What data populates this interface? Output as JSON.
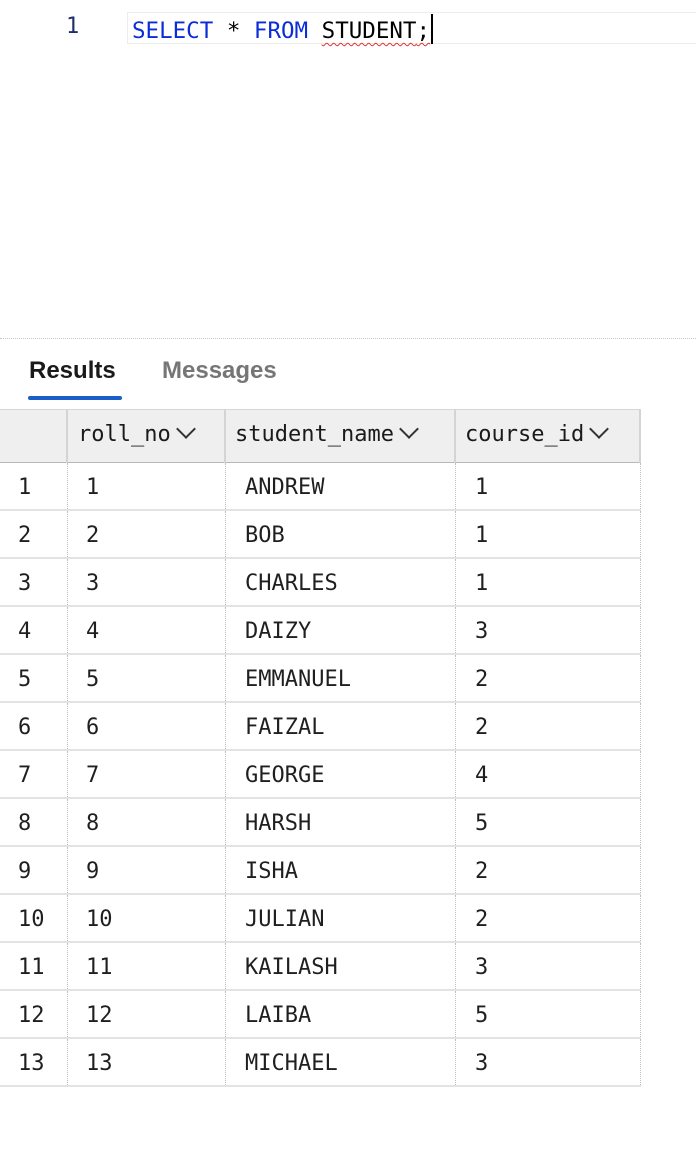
{
  "editor": {
    "line_number": "1",
    "code": {
      "kw_select": "SELECT",
      "star": "*",
      "kw_from": "FROM",
      "table": "STUDENT",
      "terminator": ";"
    }
  },
  "tabs": [
    {
      "label": "Results",
      "active": true
    },
    {
      "label": "Messages",
      "active": false
    }
  ],
  "grid": {
    "columns": [
      "roll_no",
      "student_name",
      "course_id"
    ],
    "rows": [
      {
        "index": "1",
        "roll_no": "1",
        "student_name": "ANDREW",
        "course_id": "1"
      },
      {
        "index": "2",
        "roll_no": "2",
        "student_name": "BOB",
        "course_id": "1"
      },
      {
        "index": "3",
        "roll_no": "3",
        "student_name": "CHARLES",
        "course_id": "1"
      },
      {
        "index": "4",
        "roll_no": "4",
        "student_name": "DAIZY",
        "course_id": "3"
      },
      {
        "index": "5",
        "roll_no": "5",
        "student_name": "EMMANUEL",
        "course_id": "2"
      },
      {
        "index": "6",
        "roll_no": "6",
        "student_name": "FAIZAL",
        "course_id": "2"
      },
      {
        "index": "7",
        "roll_no": "7",
        "student_name": "GEORGE",
        "course_id": "4"
      },
      {
        "index": "8",
        "roll_no": "8",
        "student_name": "HARSH",
        "course_id": "5"
      },
      {
        "index": "9",
        "roll_no": "9",
        "student_name": "ISHA",
        "course_id": "2"
      },
      {
        "index": "10",
        "roll_no": "10",
        "student_name": "JULIAN",
        "course_id": "2"
      },
      {
        "index": "11",
        "roll_no": "11",
        "student_name": "KAILASH",
        "course_id": "3"
      },
      {
        "index": "12",
        "roll_no": "12",
        "student_name": "LAIBA",
        "course_id": "5"
      },
      {
        "index": "13",
        "roll_no": "13",
        "student_name": "MICHAEL",
        "course_id": "3"
      }
    ]
  },
  "colors": {
    "keyword": "#0a2dd9",
    "squiggle": "#e0322f",
    "tab_accent": "#1a5fc6",
    "header_bg": "#efefef"
  },
  "icons": {
    "column_sort": "chevron-down-icon"
  }
}
